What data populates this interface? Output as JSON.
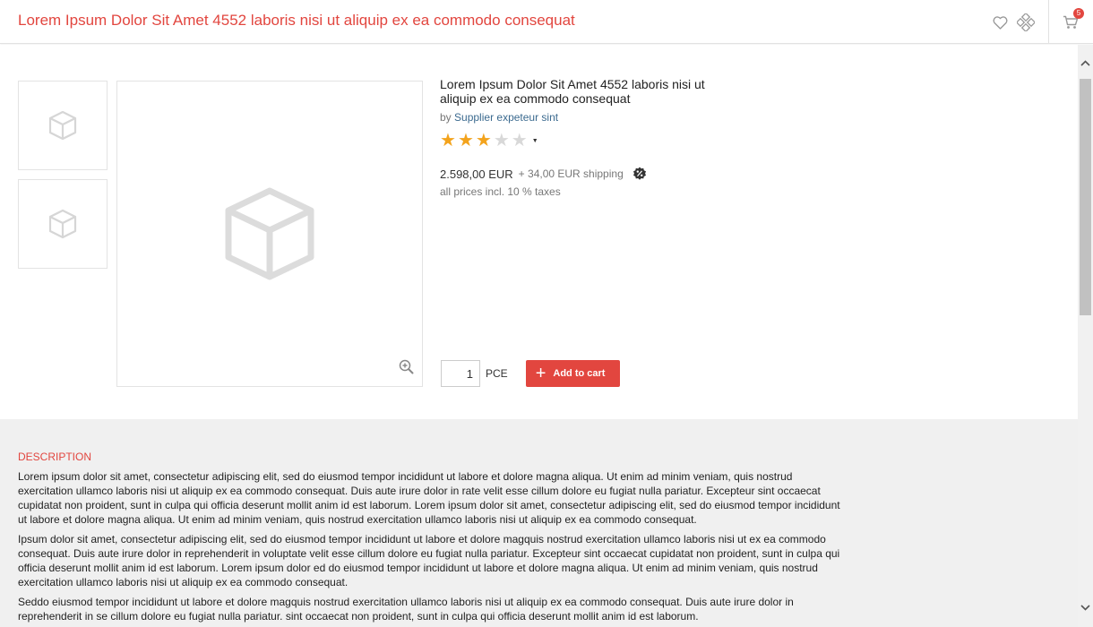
{
  "header": {
    "title": "Lorem Ipsum Dolor Sit Amet 4552 laboris nisi ut aliquip ex ea commodo consequat",
    "wishlist_icon": "heart-icon",
    "compare_icon": "compare-icon",
    "cart_icon": "cart-icon",
    "cart_count": "5"
  },
  "gallery": {
    "thumbnail_icon": "cube-icon",
    "zoom_icon": "zoom-in-icon"
  },
  "product": {
    "title": "Lorem Ipsum Dolor Sit Amet 4552 laboris nisi ut aliquip ex ea commodo consequat",
    "by_label": "by",
    "supplier": "Supplier expeteur sint",
    "rating": 3,
    "rating_max": 5,
    "price": "2.598,00 EUR",
    "shipping": "+ 34,00 EUR shipping",
    "discount_icon": "discount-badge-icon",
    "taxes": "all prices incl. 10 % taxes",
    "quantity": "1",
    "unit": "PCE",
    "add_to_cart_label": "Add to cart"
  },
  "description": {
    "heading": "DESCRIPTION",
    "paragraphs": [
      "Lorem ipsum dolor sit amet, consectetur adipiscing elit, sed do eiusmod tempor incididunt ut labore et dolore magna aliqua. Ut enim ad minim veniam, quis nostrud exercitation ullamco laboris nisi ut aliquip ex ea commodo consequat. Duis aute irure dolor in rate velit esse cillum dolore eu fugiat nulla pariatur. Excepteur sint occaecat cupidatat non proident, sunt in culpa qui officia deserunt mollit anim id est laborum. Lorem ipsum dolor sit amet, consectetur adipiscing elit, sed do eiusmod tempor incididunt ut labore et dolore magna aliqua. Ut enim ad minim veniam, quis nostrud exercitation ullamco laboris nisi ut aliquip ex ea commodo consequat.",
      "Ipsum dolor sit amet, consectetur adipiscing elit, sed do eiusmod tempor incididunt ut labore et dolore magquis nostrud exercitation ullamco laboris nisi ut ex ea commodo consequat. Duis aute irure dolor in reprehenderit in voluptate velit esse cillum dolore eu fugiat nulla pariatur. Excepteur sint occaecat cupidatat non proident, sunt in culpa qui officia deserunt mollit anim id est laborum. Lorem ipsum dolor ed do eiusmod tempor incididunt ut labore et dolore magna aliqua. Ut enim ad minim veniam, quis nostrud exercitation ullamco laboris nisi ut aliquip ex ea commodo consequat.",
      "Seddo eiusmod tempor incididunt ut labore et dolore magquis nostrud exercitation ullamco laboris nisi ut aliquip ex ea commodo consequat. Duis aute irure dolor in reprehenderit in se cillum dolore eu fugiat nulla pariatur. sint occaecat non proident, sunt in culpa qui officia deserunt mollit anim id est laborum."
    ]
  },
  "colors": {
    "accent": "#e2463f",
    "star": "#f3a31c",
    "link": "#3b6a8f",
    "description_bg": "#f0f0f0"
  }
}
